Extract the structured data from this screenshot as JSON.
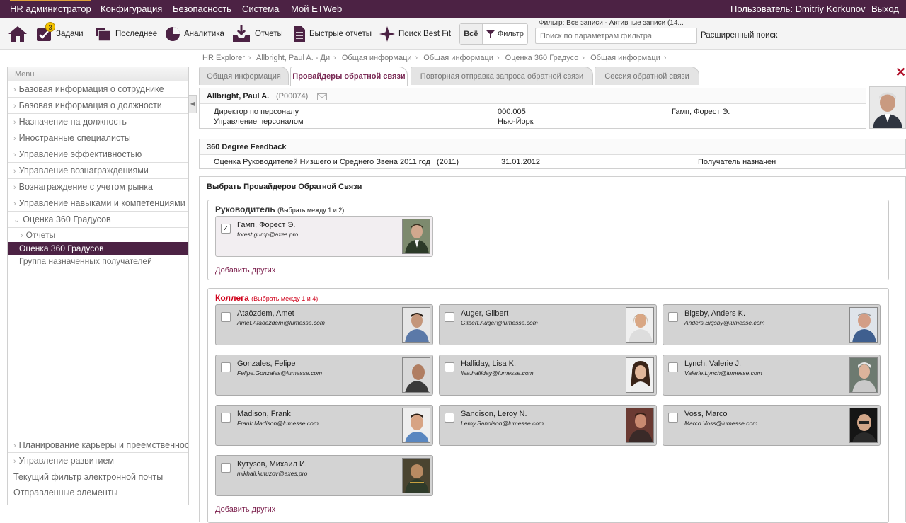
{
  "topnav": {
    "items": [
      "HR администратор",
      "Конфигурация",
      "Безопасность",
      "Система",
      "Мой ETWeb"
    ],
    "user": "Пользователь: Dmitriy Korkunov",
    "logout": "Выход",
    "accent": "#4c2244"
  },
  "toolbar": {
    "home_icon": "home-icon",
    "tasks": {
      "label": "Задачи",
      "badge": "3"
    },
    "recent": "Последнее",
    "analytics": "Аналитика",
    "reports": "Отчеты",
    "quick_reports": "Быстрые отчеты",
    "bestfit": "Поиск Best Fit",
    "all": "Всё",
    "filter": "Фильтр",
    "filter_status": "Фильтр: Все записи - Активные записи (14...",
    "search_placeholder": "Поиск по параметрам фильтра",
    "advanced": "Расширенный поиск"
  },
  "breadcrumb": [
    "HR Explorer",
    "Allbright, Paul A. - Ди",
    "Общая информаци",
    "Общая информаци",
    "Оценка 360 Градусо",
    "Общая информаци"
  ],
  "sidebar": {
    "header": "Menu",
    "items": [
      "Базовая информация о сотруднике",
      "Базовая информация о должности",
      "Назначение на должность",
      "Иностранные специалисты",
      "Управление эффективностью",
      "Управление вознаграждениями",
      "Вознаграждение с учетом рынка",
      "Управление навыками и компетенциями",
      "Оценка 360 Градусов"
    ],
    "sub": [
      "Отчеты",
      "Оценка 360 Градусов",
      "Группа назначенных получателей"
    ],
    "bottom": [
      "Планирование карьеры и преемственности",
      "Управление развитием"
    ],
    "plain": [
      "Текущий фильтр электронной почты",
      "Отправленные элементы"
    ]
  },
  "tabs": [
    "Общая информация",
    "Провайдеры обратной связи",
    "Повторная отправка запроса обратной связи",
    "Сессия обратной связи"
  ],
  "employee": {
    "name": "Allbright, Paul A.",
    "id": "(P00074)",
    "title": "Директор по персоналу",
    "dept": "Управление персоналом",
    "code": "000.005",
    "city": "Нью-Йорк",
    "manager": "Гамп, Форест Э."
  },
  "feedback": {
    "title": "360 Degree Feedback",
    "name": "Оценка Руководителей Низшего и Среднего Звена 2011 год",
    "year": "(2011)",
    "date": "31.01.2012",
    "status": "Получатель назначен"
  },
  "providers": {
    "title": "Выбрать Провайдеров Обратной Связи",
    "manager_group": {
      "title": "Руководитель",
      "hint": "(Выбрать между 1 и 2)",
      "add": "Добавить других",
      "people": [
        {
          "name": "Гамп, Форест Э.",
          "email": "forest.gump@axes.pro",
          "checked": true
        }
      ]
    },
    "colleague_group": {
      "title": "Коллега",
      "hint": "(Выбрать между 1 и 4)",
      "add": "Добавить других",
      "title_color": "#d0021b",
      "people": [
        {
          "name": "Ataözdem, Amet",
          "email": "Amet.Ataoezdem@lumesse.com"
        },
        {
          "name": "Auger, Gilbert",
          "email": "Gilbert.Auger@lumesse.com"
        },
        {
          "name": "Bigsby, Anders K.",
          "email": "Anders.Bigsby@lumesse.com"
        },
        {
          "name": "Gonzales, Felipe",
          "email": "Felipe.Gonzales@lumesse.com"
        },
        {
          "name": "Halliday, Lisa K.",
          "email": "lisa.halliday@lumesse.com"
        },
        {
          "name": "Lynch, Valerie J.",
          "email": "Valerie.Lynch@lumesse.com"
        },
        {
          "name": "Madison, Frank",
          "email": "Frank.Madison@lumesse.com"
        },
        {
          "name": "Sandison, Leroy N.",
          "email": "Leroy.Sandison@lumesse.com"
        },
        {
          "name": "Voss, Marco",
          "email": "Marco.Voss@lumesse.com"
        },
        {
          "name": "Кутузов, Михаил И.",
          "email": "mikhail.kutuzov@axes.pro"
        }
      ]
    }
  }
}
